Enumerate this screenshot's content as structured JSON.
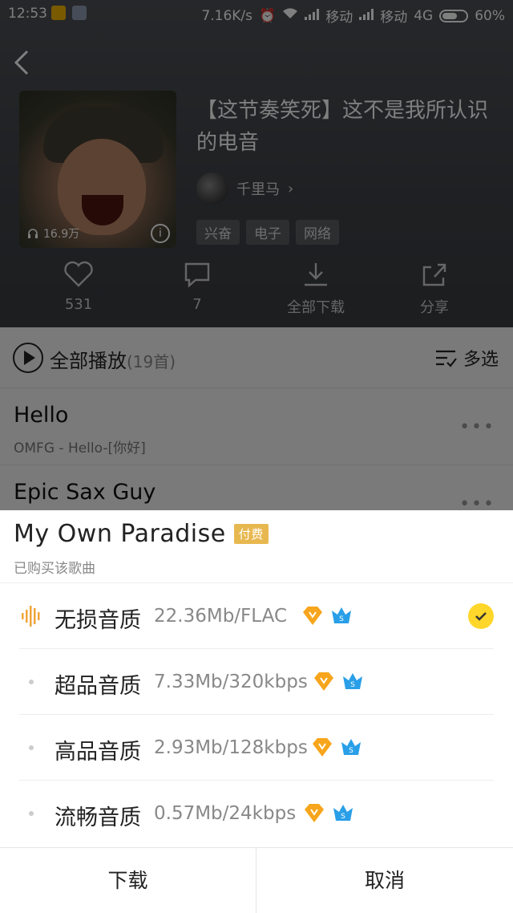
{
  "status_bar": {
    "time": "12:53",
    "speed": "7.16K/s",
    "carrier1": "移动",
    "carrier2": "移动",
    "network": "4G",
    "battery": "60%"
  },
  "playlist": {
    "title": "【这节奏笑死】这不是我所认识的电音",
    "play_count": "16.9万",
    "creator": "千里马",
    "tags": [
      "兴奋",
      "电子",
      "网络"
    ]
  },
  "actions": {
    "like_count": "531",
    "comment_count": "7",
    "download_all": "全部下载",
    "share": "分享"
  },
  "play_all": {
    "label": "全部播放",
    "count": "(19首)",
    "multi_select": "多选"
  },
  "songs": [
    {
      "name": "Hello",
      "sub": "OMFG - Hello-[你好]"
    },
    {
      "name": "Epic Sax Guy",
      "sub": ""
    }
  ],
  "sheet": {
    "song_title": "My Own Paradise",
    "paid_badge": "付费",
    "subtitle": "已购买该歌曲",
    "qualities": [
      {
        "name": "无损音质",
        "size": "22.36Mb/FLAC",
        "selected": true
      },
      {
        "name": "超品音质",
        "size": "7.33Mb/320kbps",
        "selected": false
      },
      {
        "name": "高品音质",
        "size": "2.93Mb/128kbps",
        "selected": false
      },
      {
        "name": "流畅音质",
        "size": "0.57Mb/24kbps",
        "selected": false
      }
    ],
    "download_btn": "下载",
    "cancel_btn": "取消"
  },
  "colors": {
    "accent_yellow": "#ffd62a",
    "paid_gold": "#e8b850",
    "wave_orange": "#f0a43a"
  }
}
